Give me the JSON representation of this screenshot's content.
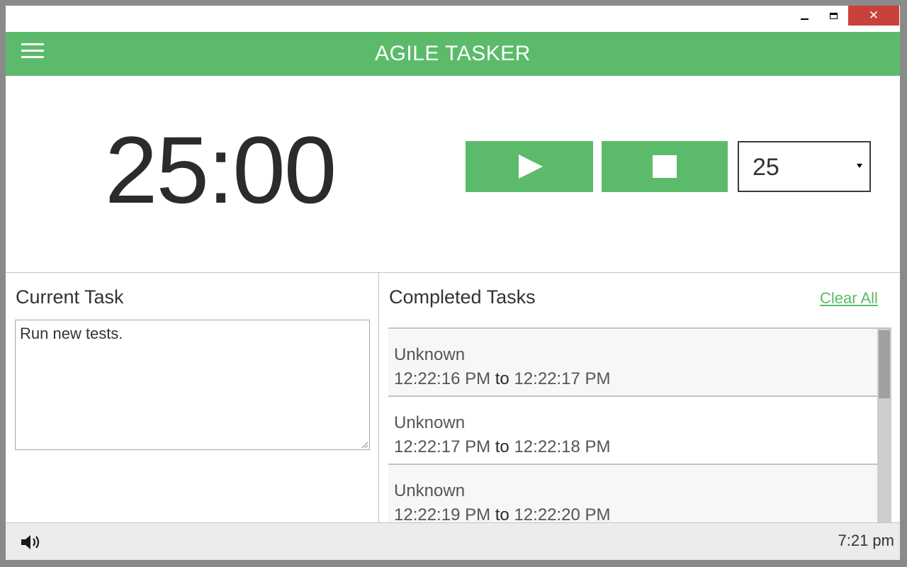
{
  "window": {
    "controls": {
      "minimize": "minimize",
      "maximize": "maximize",
      "close": "✕"
    }
  },
  "header": {
    "title": "AGILE TASKER"
  },
  "timer": {
    "display": "25:00",
    "minutes_selected": "25"
  },
  "current_task": {
    "title": "Current Task",
    "value": "Run new tests."
  },
  "completed_tasks": {
    "title": "Completed Tasks",
    "clear_all_label": "Clear All",
    "items": [
      {
        "name": "Unknown",
        "start": "12:22:16 PM",
        "sep": "to",
        "end": "12:22:17 PM"
      },
      {
        "name": "Unknown",
        "start": "12:22:17 PM",
        "sep": "to",
        "end": "12:22:18 PM"
      },
      {
        "name": "Unknown",
        "start": "12:22:19 PM",
        "sep": "to",
        "end": "12:22:20 PM"
      }
    ]
  },
  "footer": {
    "time": "7:21 pm"
  },
  "colors": {
    "accent": "#5cbb6b",
    "close": "#c9413a",
    "text": "#333333"
  },
  "icons": {
    "menu": "hamburger-menu-icon",
    "play": "play-icon",
    "stop": "stop-icon",
    "speaker": "speaker-icon",
    "dropdown": "chevron-down-icon"
  }
}
